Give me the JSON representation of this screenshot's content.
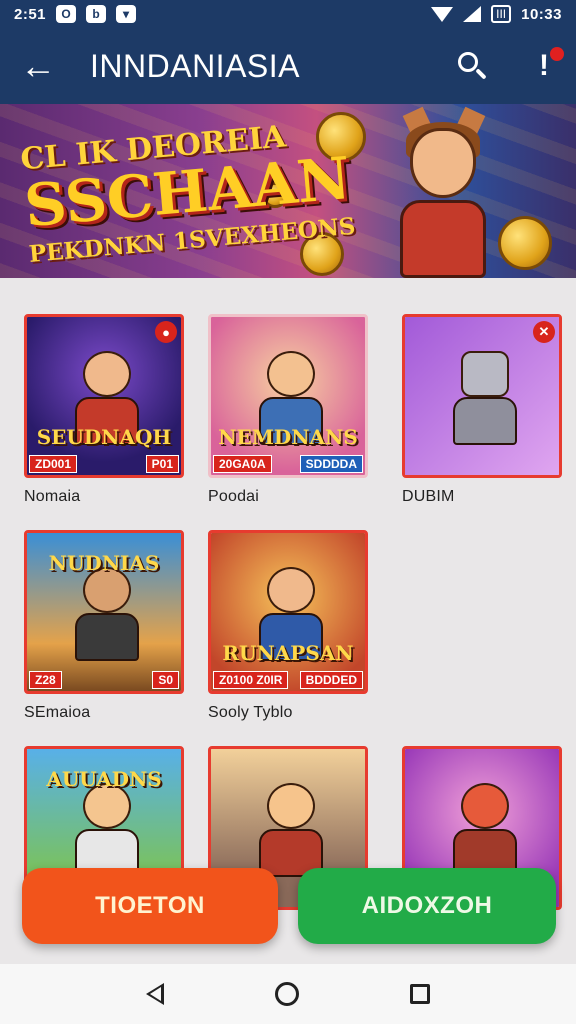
{
  "status_bar": {
    "time_left": "2:51",
    "time_right": "10:33",
    "battery_label": "III"
  },
  "app_bar": {
    "title": "INNDANIASIA",
    "back_glyph": "←",
    "alert_glyph": "!"
  },
  "banner": {
    "line1": "CL IK DEOREIA",
    "line2": "SSCHAAN",
    "line3": "PEKDNKN 1SVEXHEONS"
  },
  "games": [
    {
      "title_art": "SEUDNAQH",
      "tag_left": "ZD001",
      "tag_right": "P01",
      "label": "Nomaia"
    },
    {
      "title_art": "NEMDNANS",
      "tag_left": "20GA0A",
      "tag_right": "SDDDDA",
      "label": "Poodai"
    },
    {
      "title_art": "",
      "tag_left": "",
      "tag_right": "",
      "label": "DUBIM"
    },
    {
      "title_art": "NUDNIAS",
      "tag_left": "Z28",
      "tag_right": "S0",
      "label": "SEmaioa"
    },
    {
      "title_art": "RUNAPSAN",
      "tag_left": "Z0100 Z0IR",
      "tag_right": "BDDDED",
      "label": "Sooly Tyblo"
    },
    {
      "title_art": "AUUADNS",
      "tag_left": "",
      "tag_right": "",
      "label": ""
    },
    {
      "title_art": "",
      "tag_left": "",
      "tag_right": "",
      "label": ""
    },
    {
      "title_art": "",
      "tag_left": "",
      "tag_right": "",
      "label": ""
    }
  ],
  "buttons": {
    "primary": "TIOETON",
    "secondary": "AIDOXZOH"
  },
  "colors": {
    "app_bar": "#1d3a66",
    "primary_button": "#f2541b",
    "secondary_button": "#22ab48",
    "card_border": "#e73b2f"
  }
}
